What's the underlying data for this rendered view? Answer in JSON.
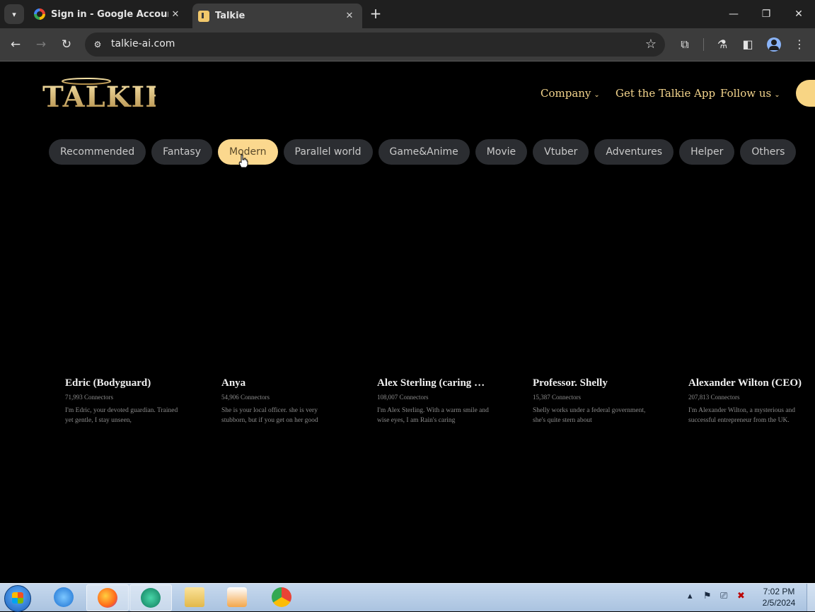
{
  "browser": {
    "tabs": [
      {
        "title": "Sign in - Google Accounts",
        "active": false
      },
      {
        "title": "Talkie",
        "active": true
      }
    ],
    "url": "talkie-ai.com",
    "new_tab_symbol": "+",
    "close_symbol": "✕"
  },
  "site": {
    "logo_text": "TALKIE",
    "nav": {
      "company": "Company",
      "get_app": "Get the Talkie App",
      "follow_us": "Follow us"
    },
    "categories": [
      {
        "label": "Recommended",
        "active": false
      },
      {
        "label": "Fantasy",
        "active": false
      },
      {
        "label": "Modern",
        "active": true
      },
      {
        "label": "Parallel world",
        "active": false
      },
      {
        "label": "Game&Anime",
        "active": false
      },
      {
        "label": "Movie",
        "active": false
      },
      {
        "label": "Vtuber",
        "active": false
      },
      {
        "label": "Adventures",
        "active": false
      },
      {
        "label": "Helper",
        "active": false
      },
      {
        "label": "Others",
        "active": false
      }
    ],
    "characters": [
      {
        "name": "Edric (Bodyguard)",
        "connectors": "71,993 Connectors",
        "description": "I'm Edric, your devoted guardian. Trained yet gentle, I stay unseen,"
      },
      {
        "name": "Anya",
        "connectors": "54,906 Connectors",
        "description": "She is your local officer. she is very stubborn, but if you get on her good"
      },
      {
        "name": "Alex Sterling (caring brother)",
        "connectors": "108,007 Connectors",
        "description": "I'm Alex Sterling. With a warm smile and wise eyes, I am Rain's caring"
      },
      {
        "name": "Professor. Shelly",
        "connectors": "15,387 Connectors",
        "description": "Shelly works under a federal government, she's quite stern about"
      },
      {
        "name": "Alexander Wilton (CEO)",
        "connectors": "207,813 Connectors",
        "description": "I'm Alexander Wilton, a mysterious and successful entrepreneur from the UK."
      }
    ]
  },
  "taskbar": {
    "time": "7:02 PM",
    "date": "2/5/2024"
  },
  "colors": {
    "accent": "#fbd88e",
    "nav_text": "#f4d58d",
    "chip_bg": "#2b2d31"
  }
}
